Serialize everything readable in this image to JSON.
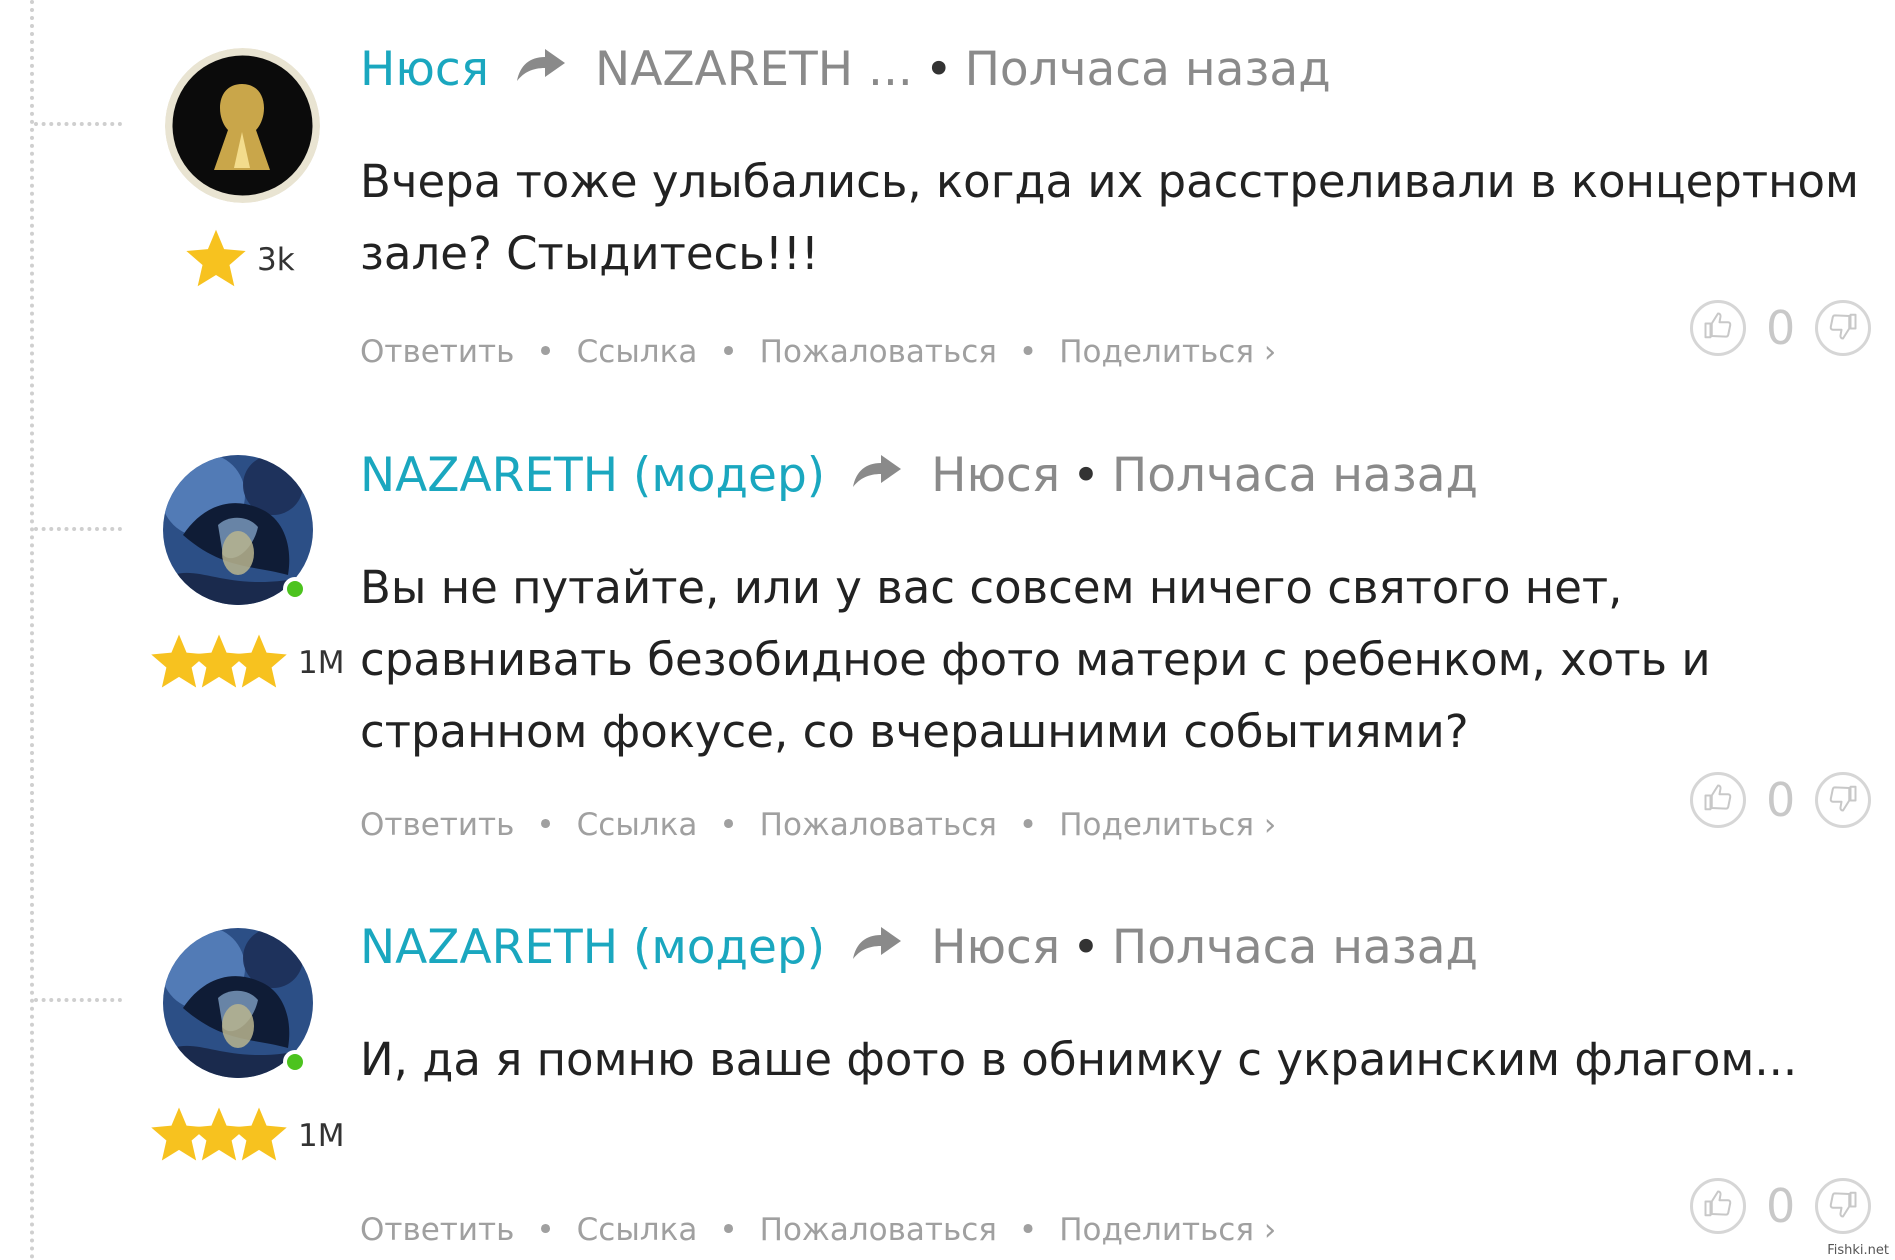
{
  "comments": [
    {
      "author": "Нюся",
      "reply_to": "NAZARETH ...",
      "time": "Полчаса назад",
      "rating": "3k",
      "stars": 1,
      "online": false,
      "text": "Вчера тоже улыбались, когда их расстреливали в концертном зале? Стыдитесь!!!",
      "votes": "0"
    },
    {
      "author": "NAZARETH (модер)",
      "reply_to": "Нюся",
      "time": "Полчаса назад",
      "rating": "1M",
      "stars": 3,
      "online": true,
      "text": "Вы не путайте, или у вас совсем ничего святого нет, сравнивать безобидное фото матери с ребенком, хоть и странном фокусе, со вчерашними событиями?",
      "votes": "0"
    },
    {
      "author": "NAZARETH (модер)",
      "reply_to": "Нюся",
      "time": "Полчаса назад",
      "rating": "1M",
      "stars": 3,
      "online": true,
      "text": "И, да я помню ваше фото в обнимку с украинским флагом...",
      "votes": "0"
    }
  ],
  "actions": {
    "reply": "Ответить",
    "link": "Ссылка",
    "report": "Пожаловаться",
    "share": "Поделиться ›"
  },
  "watermark": "Fishki.net",
  "colors": {
    "author": "#1aa7bf",
    "muted": "#8a8a8a",
    "star": "#f7c21f",
    "online": "#4cc31e"
  }
}
